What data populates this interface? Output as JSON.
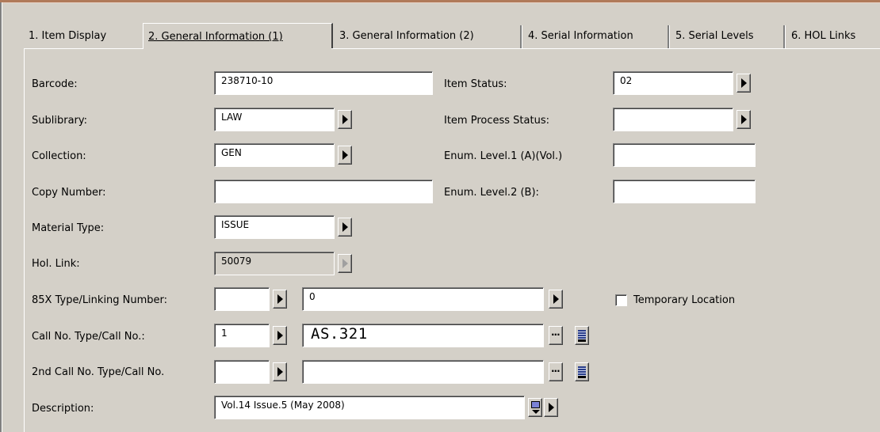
{
  "tabs": [
    {
      "label": "1. Item Display"
    },
    {
      "label": "2. General Information (1)"
    },
    {
      "label": "3. General Information (2)"
    },
    {
      "label": "4. Serial Information"
    },
    {
      "label": "5. Serial Levels"
    },
    {
      "label": "6. HOL Links"
    }
  ],
  "active_tab": "2. General Information (1)",
  "form": {
    "barcode": {
      "label": "Barcode:",
      "value": "238710-10"
    },
    "sublibrary": {
      "label": "Sublibrary:",
      "value": "LAW"
    },
    "collection": {
      "label": "Collection:",
      "value": "GEN"
    },
    "copy_number": {
      "label": "Copy Number:",
      "value": ""
    },
    "material_type": {
      "label": "Material Type:",
      "value": "ISSUE"
    },
    "hol_link": {
      "label": "Hol. Link:",
      "value": "50079"
    },
    "type_linking": {
      "label": "85X Type/Linking Number:",
      "type_value": "",
      "number_value": "0"
    },
    "call_no": {
      "label": "Call No. Type/Call No.:",
      "type_value": "1",
      "value": "AS.321"
    },
    "second_call_no": {
      "label": "2nd Call No. Type/Call No.",
      "type_value": "",
      "value": ""
    },
    "description": {
      "label": "Description:",
      "value": "Vol.14 Issue.5 (May 2008)"
    },
    "item_status": {
      "label": "Item Status:",
      "value": "02"
    },
    "item_process_status": {
      "label": "Item Process Status:",
      "value": ""
    },
    "enum_level_1": {
      "label": "Enum. Level.1 (A)(Vol.)",
      "value": ""
    },
    "enum_level_2": {
      "label": "Enum. Level.2  (B):",
      "value": ""
    },
    "temporary_location": {
      "label": "Temporary Location",
      "checked": false
    }
  },
  "icons": {
    "dropdown": "arrow-right-icon",
    "browse": "ellipsis-icon",
    "list": "list-icon",
    "updown": "spinner-icon"
  }
}
